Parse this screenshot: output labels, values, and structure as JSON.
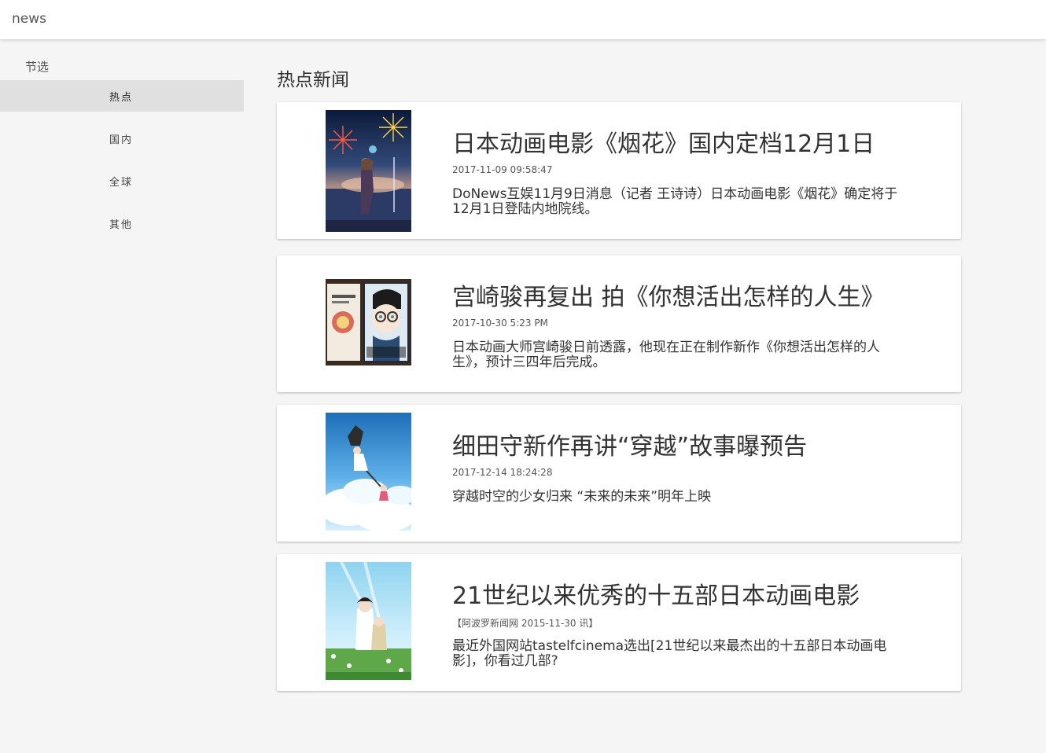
{
  "appbar": {
    "title": "news"
  },
  "sidebar": {
    "section_title": "节选",
    "items": [
      {
        "label": "热点",
        "active": true
      },
      {
        "label": "国内",
        "active": false
      },
      {
        "label": "全球",
        "active": false
      },
      {
        "label": "其他",
        "active": false
      }
    ]
  },
  "main": {
    "heading": "热点新闻",
    "articles": [
      {
        "title": "日本动画电影《烟花》国内定档12月1日",
        "date": "2017-11-09 09:58:47",
        "summary": "DoNews互娱11月9日消息（记者 王诗诗）日本动画电影《烟花》确定将于12月1日登陆内地院线。",
        "image": "fireworks-anime-poster"
      },
      {
        "title": "宫崎骏再复出 拍《你想活出怎样的人生》",
        "date": "2017-10-30 5:23 PM",
        "summary": "日本动画大师宫崎骏日前透露，他现在正在制作新作《你想活出怎样的人生》，预计三四年后完成。",
        "image": "book-covers-photo"
      },
      {
        "title": "细田守新作再讲“穿越”故事曝预告",
        "date": "2017-12-14 18:24:28",
        "summary": "穿越时空的少女归来 “未来的未来”明年上映",
        "image": "mirai-poster"
      },
      {
        "title": "21世纪以来优秀的十五部日本动画电影",
        "date": "【阿波罗新闻网 2015-11-30 讯】",
        "summary": "最近外国网站tastelfcinema选出[21世纪以来最杰出的十五部日本动画电影]，你看过几部?",
        "image": "wolf-children-poster"
      }
    ]
  }
}
